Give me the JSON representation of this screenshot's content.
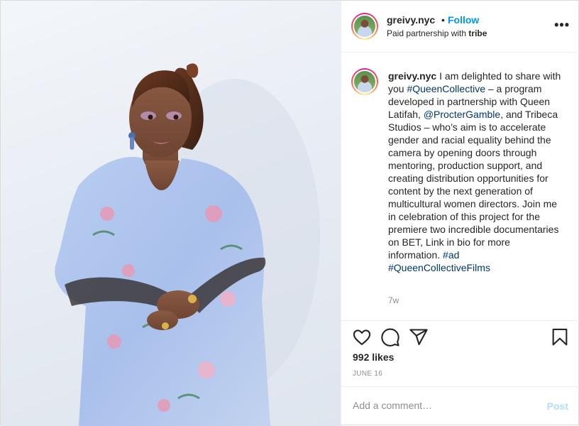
{
  "post": {
    "username": "greivy.nyc",
    "separator": "•",
    "follow_label": "Follow",
    "partnership_prefix": "Paid partnership with",
    "partner": "tribe",
    "more_label": "•••",
    "caption": {
      "username": "greivy.nyc",
      "part1": " I am delighted to share with you ",
      "hashtag1": "#QueenCollective",
      "part2": " – a program developed in partnership with Queen Latifah, ",
      "mention": "@ProcterGamble",
      "part3": ", and Tribeca Studios – who’s aim is to accelerate gender and racial equality behind the camera by opening doors through mentoring, production support, and creating distribution opportunities for content by the next generation of multicultural women directors. Join me in celebration of this project for the premiere two incredible documentaries on BET, Link in bio for more information. ",
      "hashtag2": "#ad",
      "hashtag3": "#QueenCollectiveFilms"
    },
    "time_ago": "7w",
    "likes": "992 likes",
    "date": "JUNE 16",
    "comment_placeholder": "Add a comment…",
    "post_label": "Post"
  },
  "icons": {
    "like": "heart-icon",
    "comment": "comment-icon",
    "share": "paper-plane-icon",
    "save": "bookmark-icon",
    "more": "more-options-icon"
  },
  "colors": {
    "link_blue": "#0095f6",
    "hashtag": "#00376b",
    "muted": "#8e8e8e",
    "post_disabled": "#b2dffc"
  }
}
